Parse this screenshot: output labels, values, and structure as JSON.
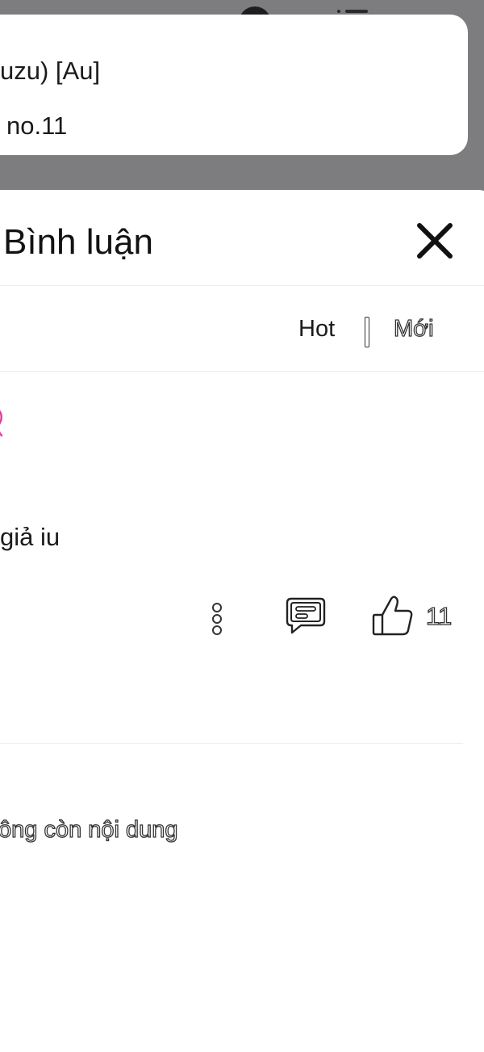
{
  "info_card": {
    "line1": "uzu) [Au]",
    "line2": "no.11"
  },
  "comments_sheet": {
    "title": "Bình luận",
    "sort": {
      "hot_label": "Hot",
      "new_label": "Mới"
    },
    "comment": {
      "text": "giả iu",
      "like_count": "11"
    },
    "end_message": "ông còn nội dung"
  },
  "icons": [
    "status-dot-icon",
    "list-icon",
    "close-icon",
    "more-vertical-icon",
    "reply-icon",
    "thumbs-up-icon"
  ],
  "colors": {
    "scrim": "#7d7d80",
    "sheet_background": "#ffffff",
    "accent_pink": "#e0429a",
    "text": "#1b1b1b"
  }
}
